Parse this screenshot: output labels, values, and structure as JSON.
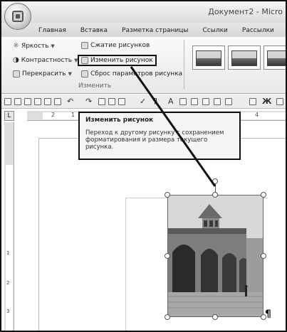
{
  "window": {
    "title": "Документ2 - Micro"
  },
  "tabs": [
    {
      "label": "Главная"
    },
    {
      "label": "Вставка"
    },
    {
      "label": "Разметка страницы"
    },
    {
      "label": "Ссылки"
    },
    {
      "label": "Рассылки"
    }
  ],
  "ribbon": {
    "brightness_label": "Яркость",
    "contrast_label": "Контрастность",
    "recolor_label": "Перекрасить",
    "compress_label": "Сжатие рисунков",
    "change_label": "Изменить рисунок",
    "reset_label": "Сброс параметров рисунка",
    "group_label": "Изменить"
  },
  "ruler": {
    "corner": "L",
    "h_numbers": [
      "2",
      "1",
      "4"
    ],
    "v_numbers": [
      "1",
      "2",
      "3"
    ]
  },
  "tooltip": {
    "title": "Изменить рисунок",
    "body": "Переход к другому рисунку с сохранением форматирования и размера текущего рисунка."
  },
  "document": {
    "paragraph_mark": "¶"
  }
}
